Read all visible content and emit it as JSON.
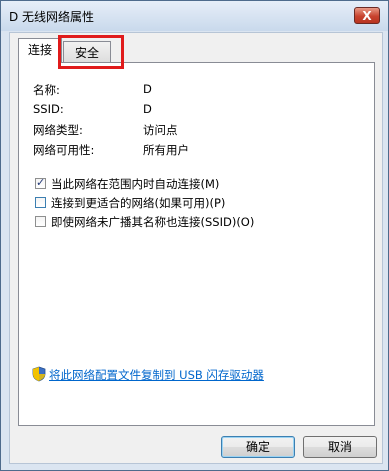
{
  "window": {
    "title": "D 无线网络属性",
    "close_label": "X"
  },
  "tabs": [
    {
      "label": "连接",
      "active": true
    },
    {
      "label": "安全",
      "active": false
    }
  ],
  "info": [
    {
      "label": "名称:",
      "value": "D"
    },
    {
      "label": "SSID:",
      "value": "D"
    },
    {
      "label": "网络类型:",
      "value": "访问点"
    },
    {
      "label": "网络可用性:",
      "value": "所有用户"
    }
  ],
  "options": [
    {
      "label": "当此网络在范围内时自动连接(M)",
      "checked": true
    },
    {
      "label": "连接到更适合的网络(如果可用)(P)",
      "checked": false
    },
    {
      "label": "即使网络未广播其名称也连接(SSID)(O)",
      "checked": false
    }
  ],
  "link": {
    "label": "将此网络配置文件复制到 USB 闪存驱动器",
    "icon": "shield-icon"
  },
  "buttons": {
    "ok": "确定",
    "cancel": "取消"
  },
  "colors": {
    "highlight": "#e01b1b",
    "link": "#0066cc"
  }
}
